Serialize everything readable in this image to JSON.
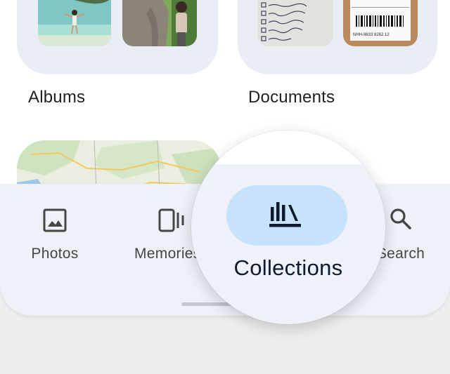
{
  "collections": {
    "albums_label": "Albums",
    "documents_label": "Documents",
    "document_barcode_text": "NHH-9633 8262 12",
    "document_checklist_lines": [
      "Printing",
      "Exchange",
      "Email",
      "Pick up",
      "Pick up",
      "Buy",
      "Call"
    ]
  },
  "nav": {
    "items": [
      {
        "label": "Photos",
        "icon": "photo-icon"
      },
      {
        "label": "Memories",
        "icon": "memories-icon"
      },
      {
        "label": "Collections",
        "icon": "collections-icon",
        "selected": true
      },
      {
        "label": "Search",
        "icon": "search-icon"
      }
    ]
  },
  "colors": {
    "selected_pill": "#c6e3fb",
    "nav_background": "#eef1f8",
    "label_text": "#444746",
    "selected_text": "#0f1b2d"
  }
}
